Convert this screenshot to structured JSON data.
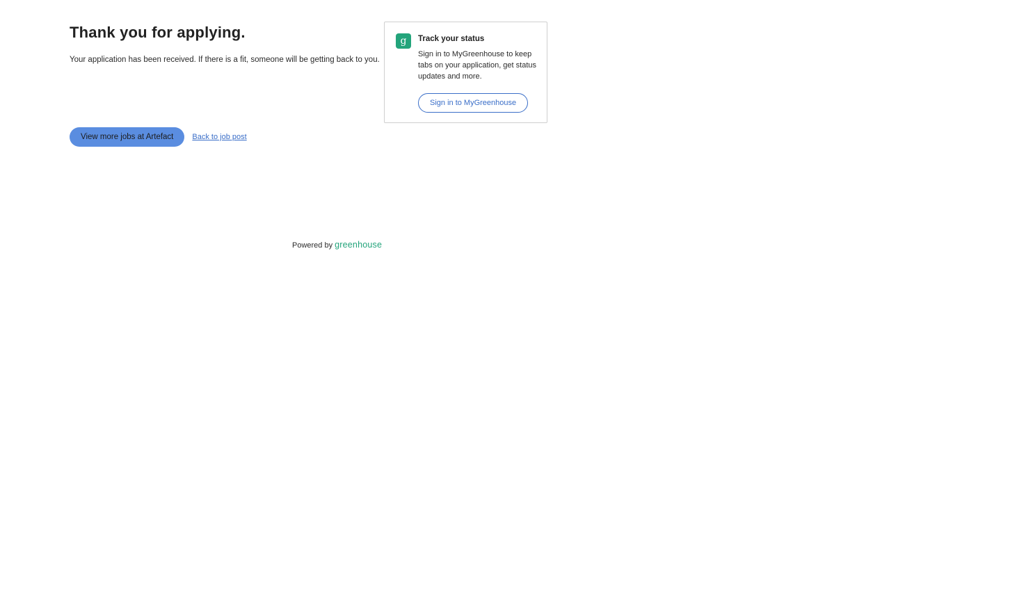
{
  "confirmation": {
    "title": "Thank you for applying.",
    "message": "Your application has been received. If there is a fit, someone will be getting back to you."
  },
  "actions": {
    "view_more_jobs_label": "View more jobs at Artefact",
    "back_link_label": "Back to job post"
  },
  "status_card": {
    "logo_glyph": "g",
    "title": "Track your status",
    "text": "Sign in to MyGreenhouse to keep tabs on your application, get status updates and more.",
    "sign_in_label": "Sign in to MyGreenhouse"
  },
  "footer": {
    "powered_by": "Powered by",
    "brand": "greenhouse"
  },
  "colors": {
    "primary_button": "#5a8de0",
    "link": "#3a6ec8",
    "brand_green": "#23a47b"
  }
}
